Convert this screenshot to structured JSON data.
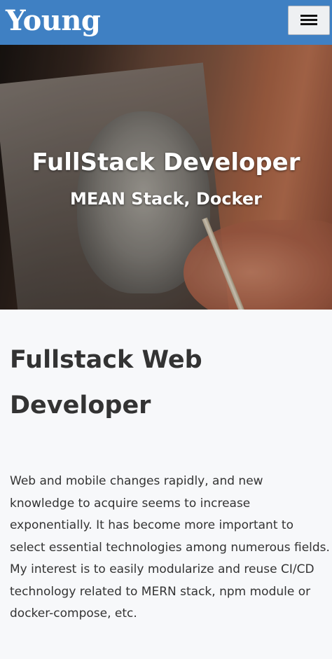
{
  "navbar": {
    "brand": "Young",
    "menu_icon": "hamburger-icon",
    "color": "#3f80c3"
  },
  "hero": {
    "title": "FullStack Developer",
    "subtitle": "MEAN Stack, Docker"
  },
  "main": {
    "heading": "Fullstack Web Developer",
    "body": "Web and mobile changes rapidly, and new knowledge to acquire seems to increase exponentially. It has become more important to select essential technologies among numerous fields. My interest is to easily modularize and reuse CI/CD technology related to MERN stack, npm module or docker-compose, etc."
  }
}
